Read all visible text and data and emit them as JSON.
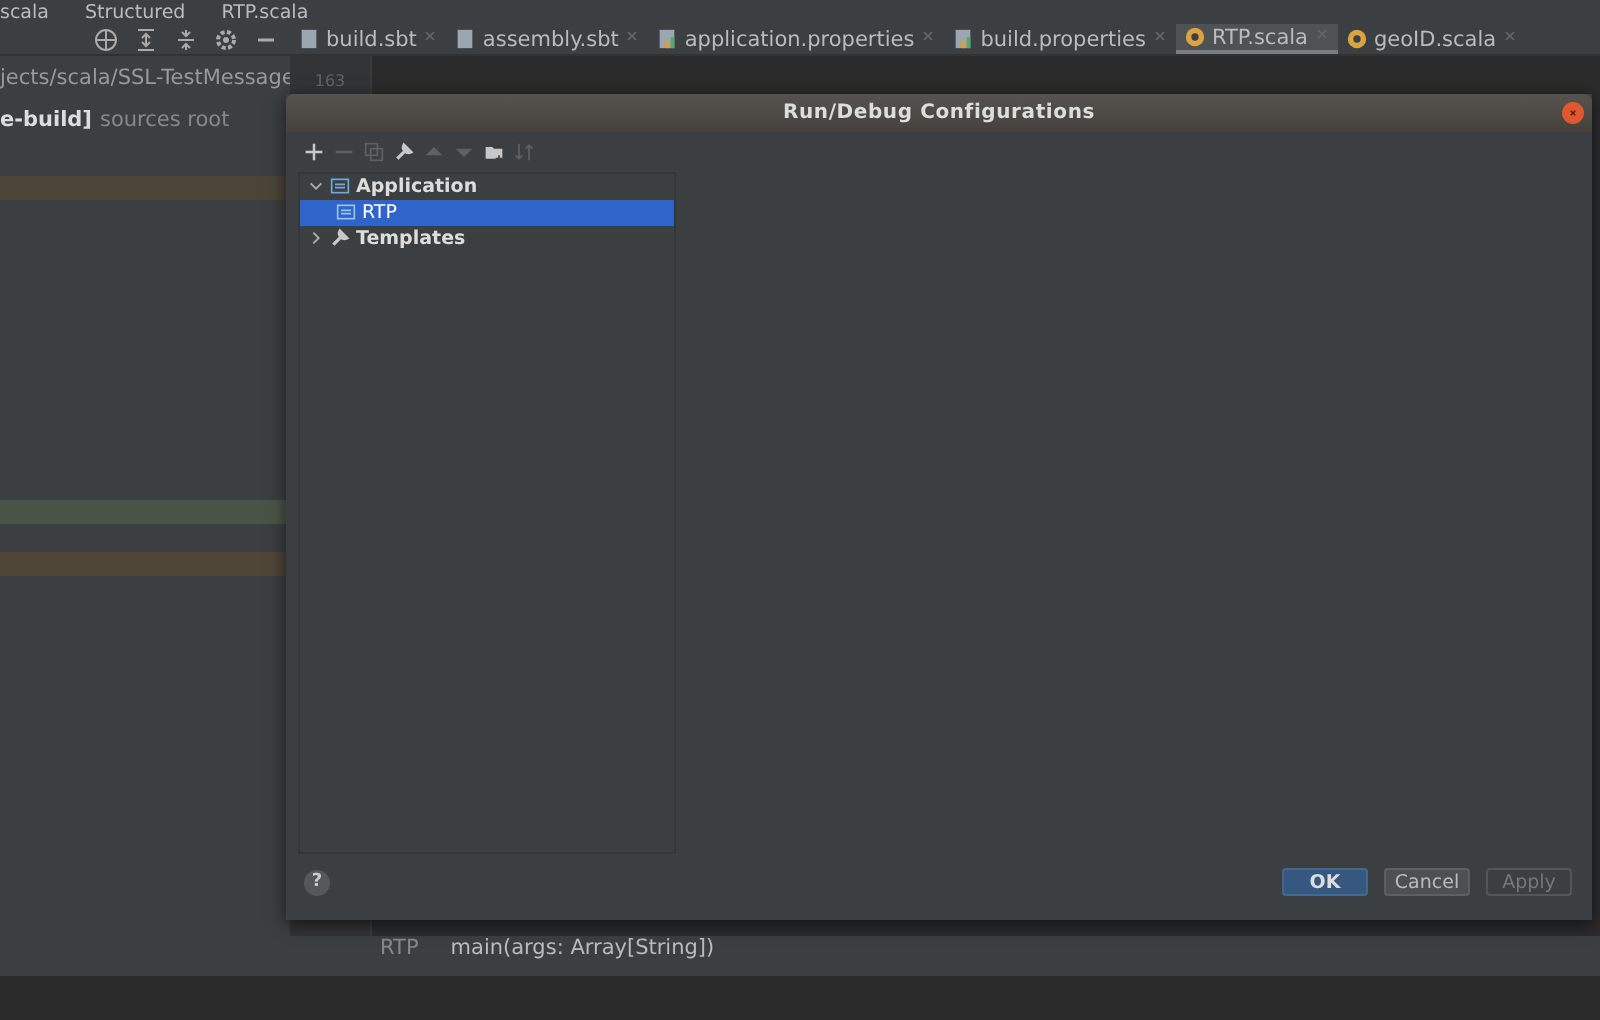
{
  "ide": {
    "breadcrumb": [
      "scala",
      "Structured",
      "RTP.scala"
    ],
    "project_path": "jects/scala/SSL-TestMessage",
    "module": {
      "name": "e-build]",
      "note": "sources root"
    },
    "marked_rows": [
      {
        "color": "#4b4438"
      },
      {
        "color": "#4a5446"
      },
      {
        "color": "#4f4638"
      }
    ],
    "tabs": [
      {
        "label": "build.sbt",
        "kind": "sbt",
        "selected": false
      },
      {
        "label": "assembly.sbt",
        "kind": "sbt",
        "selected": false
      },
      {
        "label": "application.properties",
        "kind": "properties",
        "selected": false
      },
      {
        "label": "build.properties",
        "kind": "properties",
        "selected": false
      },
      {
        "label": "RTP.scala",
        "kind": "scala",
        "selected": true
      },
      {
        "label": "geoID.scala",
        "kind": "scala",
        "selected": false
      }
    ],
    "line_numbers": [
      "163"
    ],
    "bottom_breadcrumb": [
      "RTP",
      "main(args: Array[String])"
    ]
  },
  "dialog": {
    "title": "Run/Debug Configurations",
    "help": "?",
    "toolbar": [
      {
        "kind": "add",
        "disabled": false
      },
      {
        "kind": "remove",
        "disabled": true
      },
      {
        "kind": "copy",
        "disabled": true
      },
      {
        "kind": "edit",
        "disabled": false
      },
      {
        "kind": "up",
        "disabled": true
      },
      {
        "kind": "down",
        "disabled": true
      },
      {
        "kind": "folder",
        "disabled": false
      },
      {
        "kind": "sort",
        "disabled": true
      }
    ],
    "tree": [
      {
        "label": "Application",
        "kind": "application",
        "expanded": true,
        "selected": false,
        "children": [
          {
            "label": "RTP",
            "kind": "config",
            "selected": true
          }
        ]
      },
      {
        "label": "Templates",
        "kind": "templates",
        "expanded": false,
        "selected": false
      }
    ],
    "buttons": [
      {
        "label": "OK",
        "kind": "default",
        "disabled": false
      },
      {
        "label": "Cancel",
        "kind": "normal",
        "disabled": false
      },
      {
        "label": "Apply",
        "kind": "normal",
        "disabled": true
      }
    ]
  }
}
